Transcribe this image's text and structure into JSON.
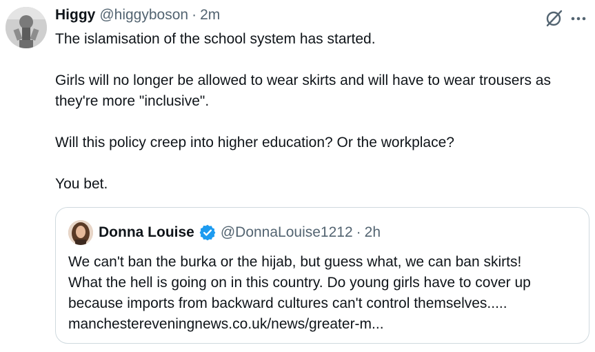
{
  "post": {
    "author": {
      "name": "Higgy",
      "handle": "@higgyboson",
      "time": "2m"
    },
    "separator": "·",
    "icons": {
      "grok": "grok-icon",
      "more": "more-icon"
    },
    "body": [
      "The islamisation of the school system has started.",
      "Girls will no longer be allowed to wear skirts and will have to wear trousers as they're more \"inclusive\".",
      "Will this policy creep into higher education? Or the workplace?",
      "You bet."
    ]
  },
  "quote": {
    "author": {
      "name": "Donna Louise",
      "handle": "@DonnaLouise1212",
      "time": "2h",
      "verified": true
    },
    "separator": "·",
    "lines": [
      "We can't ban the burka or the hijab, but guess what, we can ban skirts!",
      "What the hell is going on in this country. Do young girls have to cover up",
      "because imports from backward cultures can't control themselves.....",
      "manchestereveningnews.co.uk/news/greater-m..."
    ]
  },
  "colors": {
    "text": "#0f1419",
    "secondary": "#536471",
    "border": "#cfd9de",
    "verified": "#1d9bf0"
  }
}
